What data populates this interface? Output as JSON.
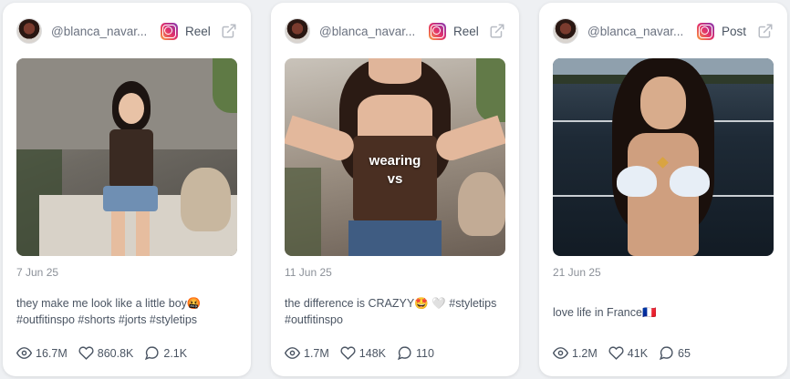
{
  "cards": [
    {
      "username": "@blanca_navar...",
      "post_type": "Reel",
      "overlay": [],
      "date": "7 Jun 25",
      "caption": "they make me look like a little boy🤬 #outfitinspo #shorts #jorts #styletips",
      "views": "16.7M",
      "likes": "860.8K",
      "comments": "2.1K"
    },
    {
      "username": "@blanca_navar...",
      "post_type": "Reel",
      "overlay": [
        "wearing",
        "vs"
      ],
      "date": "11 Jun 25",
      "caption": "the difference is CRAZYY🤩 🤍 #styletips #outfitinspo",
      "views": "1.7M",
      "likes": "148K",
      "comments": "110"
    },
    {
      "username": "@blanca_navar...",
      "post_type": "Post",
      "overlay": [],
      "date": "21 Jun 25",
      "caption": "love life in France🇫🇷",
      "views": "1.2M",
      "likes": "41K",
      "comments": "65"
    }
  ]
}
